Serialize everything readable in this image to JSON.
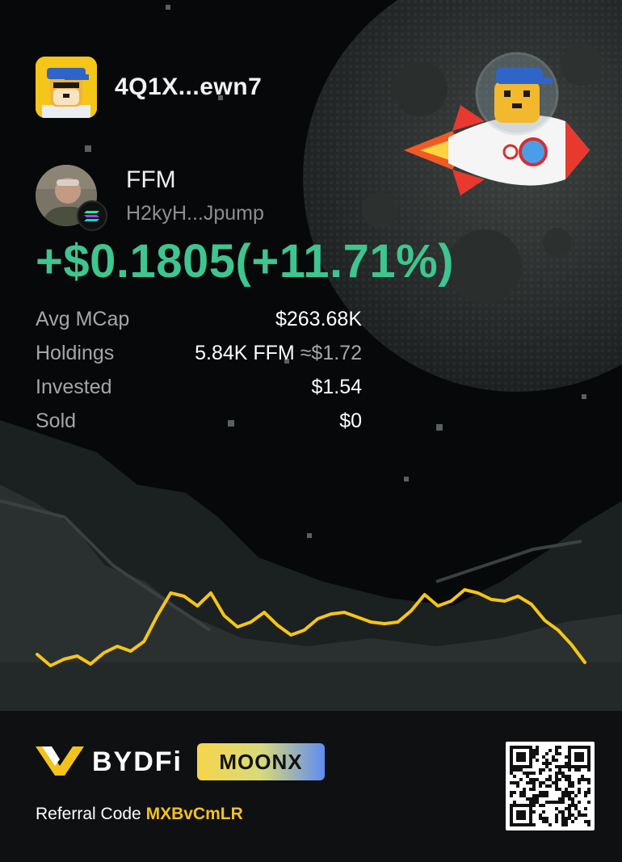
{
  "user": {
    "name": "4Q1X...ewn7"
  },
  "token": {
    "symbol": "FFM",
    "address": "H2kyH...Jpump",
    "chain_icon": "solana-icon"
  },
  "pnl": {
    "text": "+$0.1805(+11.71%)",
    "color": "#3fc58f"
  },
  "stats": [
    {
      "label": "Avg MCap",
      "value": "$263.68K",
      "approx": ""
    },
    {
      "label": "Holdings",
      "value": "5.84K FFM",
      "approx": "≈$1.72"
    },
    {
      "label": "Invested",
      "value": "$1.54",
      "approx": ""
    },
    {
      "label": "Sold",
      "value": "$0",
      "approx": ""
    }
  ],
  "chart_data": {
    "type": "line",
    "title": "",
    "xlabel": "",
    "ylabel": "",
    "grid": false,
    "legend": "none",
    "x": [
      0,
      1,
      2,
      3,
      4,
      5,
      6,
      7,
      8,
      9,
      10,
      11,
      12,
      13,
      14,
      15,
      16,
      17,
      18,
      19,
      20,
      21,
      22,
      23,
      24,
      25,
      26,
      27,
      28,
      29,
      30,
      31,
      32,
      33,
      34,
      35,
      36,
      37,
      38,
      39,
      40,
      41
    ],
    "y": [
      0.2,
      0.06,
      0.14,
      0.18,
      0.08,
      0.22,
      0.3,
      0.24,
      0.36,
      0.68,
      0.96,
      0.92,
      0.8,
      0.96,
      0.68,
      0.54,
      0.6,
      0.72,
      0.56,
      0.44,
      0.5,
      0.64,
      0.7,
      0.72,
      0.66,
      0.6,
      0.58,
      0.6,
      0.74,
      0.94,
      0.8,
      0.86,
      1.0,
      0.96,
      0.88,
      0.86,
      0.92,
      0.82,
      0.62,
      0.5,
      0.32,
      0.1
    ],
    "ylim": [
      0,
      1
    ],
    "color": "#f5c518"
  },
  "brand": {
    "name": "BYDFi",
    "product": "MOONX",
    "accent": "#f3c31b"
  },
  "referral": {
    "label": "Referral Code",
    "code": "MXBvCmLR"
  }
}
